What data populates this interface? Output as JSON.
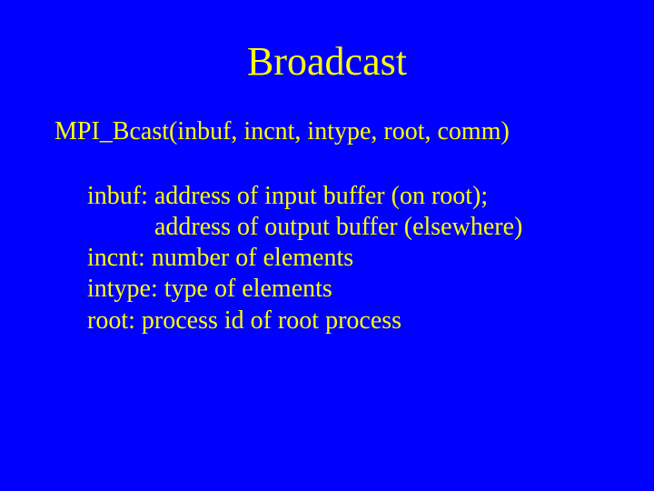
{
  "title": "Broadcast",
  "signature": "MPI_Bcast(inbuf, incnt, intype, root, comm)",
  "desc": {
    "inbuf1": "inbuf: address of input buffer (on root);",
    "inbuf2": "address of output buffer (elsewhere)",
    "incnt": "incnt: number of elements",
    "intype": "intype: type of elements",
    "root": "root: process id of root process"
  }
}
